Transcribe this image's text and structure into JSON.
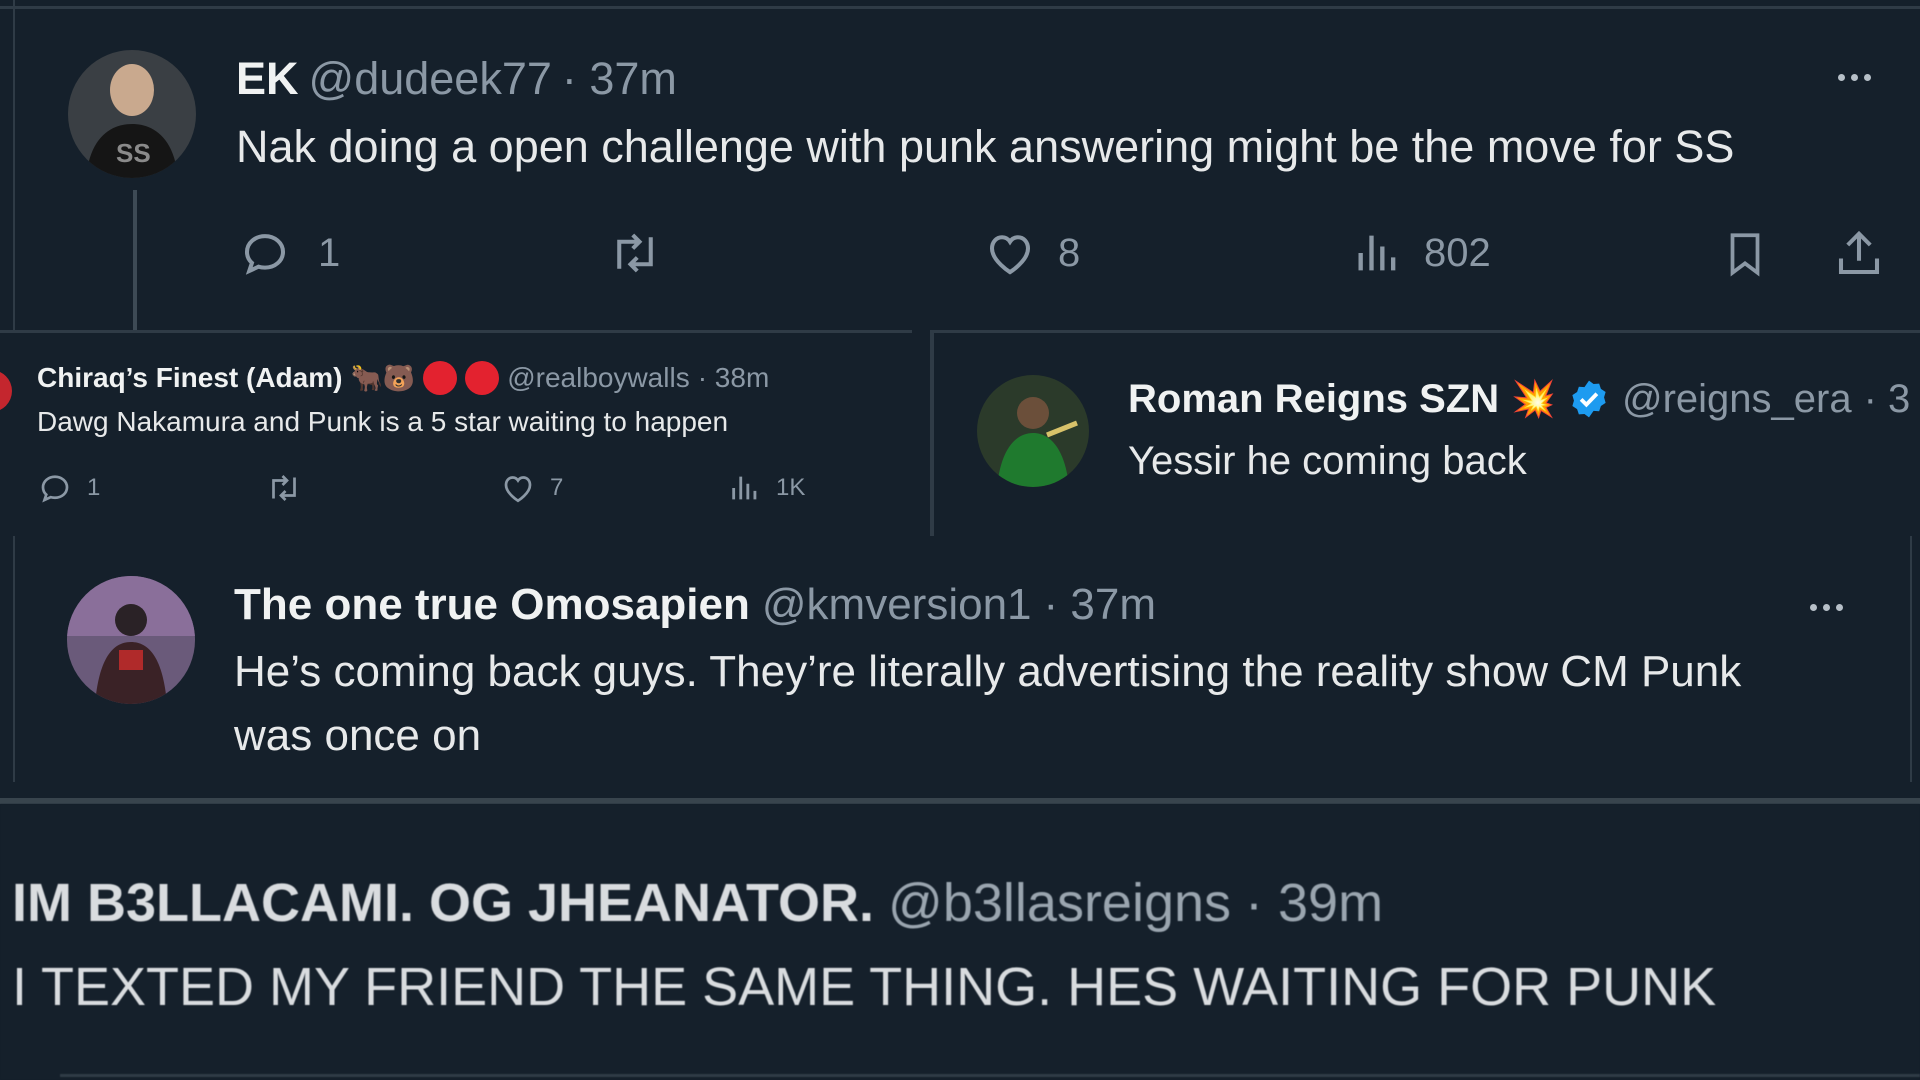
{
  "tweet_ek": {
    "name": "EK",
    "handle": "@dudeek77",
    "time": "· 37m",
    "text": "Nak doing a open challenge with punk answering might be the move for SS",
    "replies": "1",
    "likes": "8",
    "views": "802"
  },
  "tweet_chiraq": {
    "name": "Chiraq’s Finest (Adam)",
    "emojis": "🐂🐻",
    "handle": "@realboywalls",
    "time": "· 38m",
    "text": "Dawg Nakamura and Punk is a 5 star waiting to happen",
    "replies": "1",
    "likes": "7",
    "views": "1K"
  },
  "tweet_roman": {
    "name": "Roman Reigns SZN",
    "emoji": "💥",
    "handle": "@reigns_era",
    "time": "· 3",
    "text": "Yessir he coming back"
  },
  "tweet_omosapien": {
    "name": "The one true Omosapien",
    "handle": "@kmversion1",
    "time": "· 37m",
    "text": "He’s coming back guys. They’re literally advertising the reality show CM Punk was once on"
  },
  "tweet_b3llas": {
    "name": "IM B3LLACAMI. OG JHEANATOR.",
    "handle": "@b3llasreigns",
    "time": "· 39m",
    "text": "I TEXTED MY FRIEND THE SAME THING. HES WAITING FOR PUNK"
  },
  "colors": {
    "background": "#15202b",
    "muted": "#8b98a5",
    "verified": "#1d9bf0",
    "divider": "#38444d"
  },
  "icons": [
    "reply-icon",
    "retweet-icon",
    "like-icon",
    "views-icon",
    "bookmark-icon",
    "share-icon",
    "more-icon",
    "verified-icon"
  ]
}
